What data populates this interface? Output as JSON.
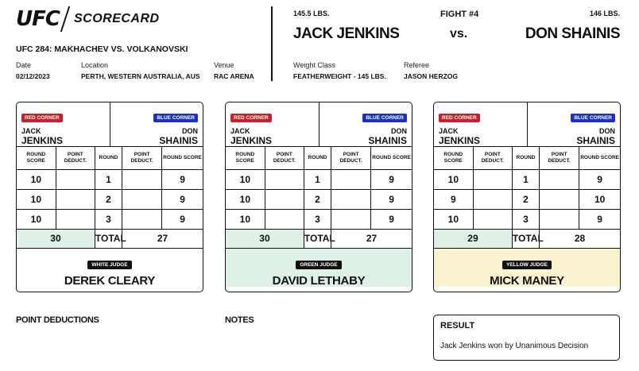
{
  "header": {
    "logo": "UFC",
    "title": "SCORECARD",
    "event": "UFC 284: MAKHACHEV VS. VOLKANOVSKI",
    "date_label": "Date",
    "date": "02/12/2023",
    "location_label": "Location",
    "location": "PERTH, WESTERN AUSTRALIA, AUS",
    "venue_label": "Venue",
    "venue": "RAC ARENA",
    "weight_class_label": "Weight Class",
    "weight_class": "FEATHERWEIGHT - 145 LBS.",
    "referee_label": "Referee",
    "referee": "JASON HERZOG"
  },
  "fight": {
    "number": "FIGHT #4",
    "vs": "vs.",
    "red_weight": "145.5 LBS.",
    "blue_weight": "146 LBS.",
    "red_fighter": "JACK JENKINS",
    "blue_fighter": "DON SHAINIS"
  },
  "labels": {
    "red_corner": "RED CORNER",
    "blue_corner": "BLUE CORNER",
    "red_first": "JACK",
    "red_last": "JENKINS",
    "blue_first": "DON",
    "blue_last": "SHAINIS",
    "round_score": "ROUND SCORE",
    "point_deduct": "POINT DEDUCT.",
    "round": "ROUND",
    "total": "TOTAL"
  },
  "cards": [
    {
      "judge_badge": "WHITE JUDGE",
      "judge_name": "DEREK CLEARY",
      "rounds": [
        {
          "round": "1",
          "red": "10",
          "blue": "9"
        },
        {
          "round": "2",
          "red": "10",
          "blue": "9"
        },
        {
          "round": "3",
          "red": "10",
          "blue": "9"
        }
      ],
      "red_total": "30",
      "blue_total": "27"
    },
    {
      "judge_badge": "GREEN JUDGE",
      "judge_name": "DAVID LETHABY",
      "rounds": [
        {
          "round": "1",
          "red": "10",
          "blue": "9"
        },
        {
          "round": "2",
          "red": "10",
          "blue": "9"
        },
        {
          "round": "3",
          "red": "10",
          "blue": "9"
        }
      ],
      "red_total": "30",
      "blue_total": "27"
    },
    {
      "judge_badge": "YELLOW JUDGE",
      "judge_name": "MICK MANEY",
      "rounds": [
        {
          "round": "1",
          "red": "10",
          "blue": "9"
        },
        {
          "round": "2",
          "red": "9",
          "blue": "10"
        },
        {
          "round": "3",
          "red": "10",
          "blue": "9"
        }
      ],
      "red_total": "29",
      "blue_total": "28"
    }
  ],
  "bottom": {
    "point_deductions_title": "POINT DEDUCTIONS",
    "notes_title": "NOTES",
    "result_title": "RESULT",
    "result_text": "Jack Jenkins won by Unanimous Decision"
  },
  "colors": {
    "red_corner": "#c8202a",
    "blue_corner": "#1b2fc4",
    "green_judge_bg": "#dff1e6",
    "yellow_judge_bg": "#fbf3cf"
  }
}
